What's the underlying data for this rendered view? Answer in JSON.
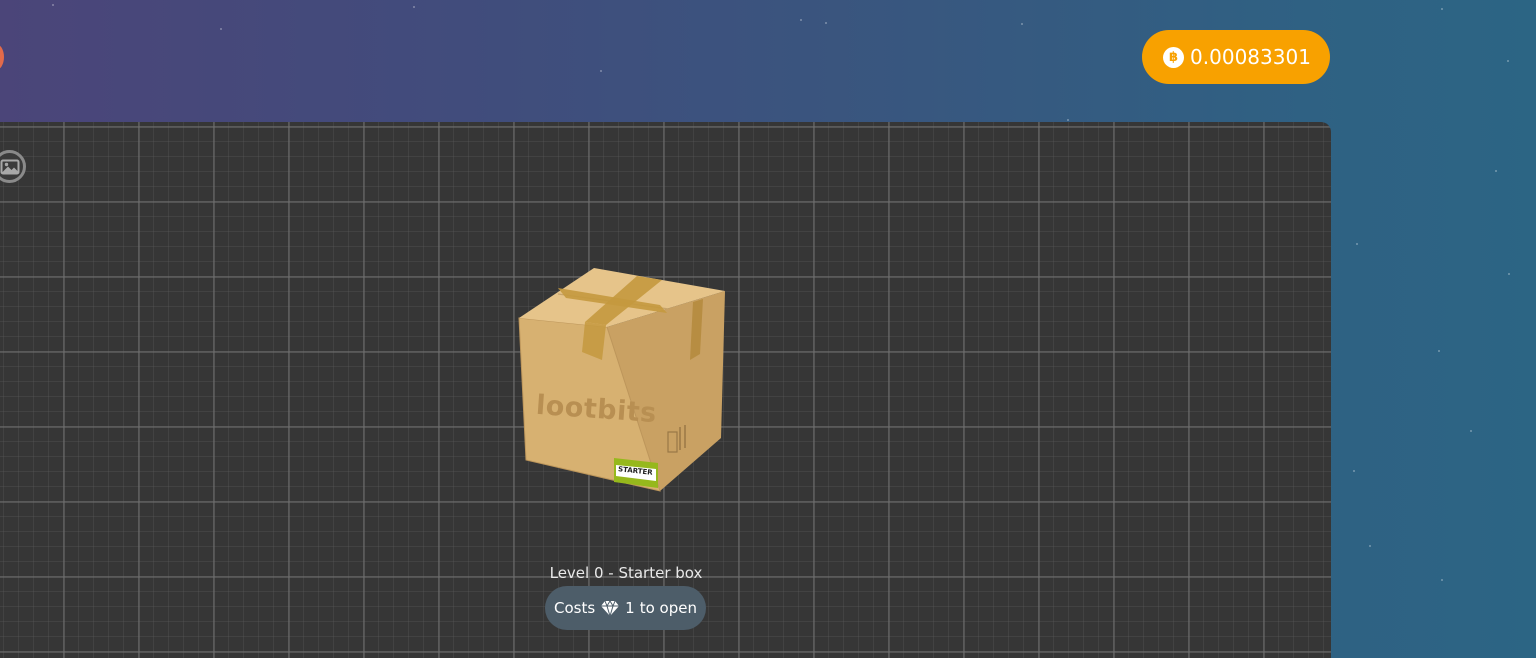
{
  "header": {
    "balance": {
      "currency_symbol": "฿",
      "amount": "0.00083301",
      "color": "#f8a100"
    }
  },
  "board": {
    "toolbar": {
      "image_toggle_icon": "image-icon"
    },
    "box": {
      "brand_text": "lootbits",
      "badge_text": "STARTER",
      "caption": "Level 0 - Starter box",
      "cost": {
        "prefix": "Costs",
        "icon": "diamond-icon",
        "amount": "1",
        "suffix": "to open"
      }
    }
  }
}
